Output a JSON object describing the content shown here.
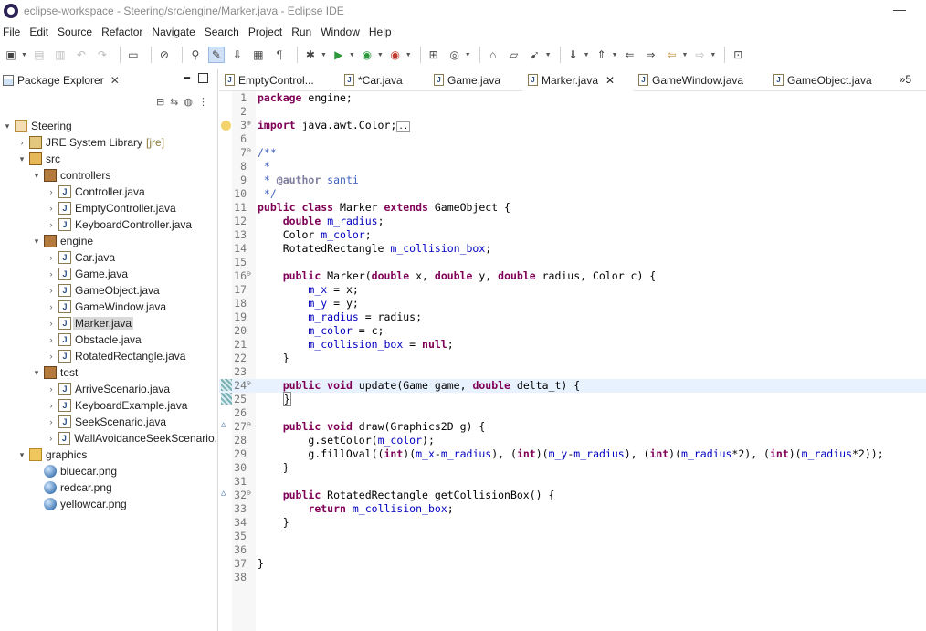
{
  "window": {
    "title": "eclipse-workspace - Steering/src/engine/Marker.java - Eclipse IDE",
    "minimize": "—"
  },
  "menu": [
    "File",
    "Edit",
    "Source",
    "Refactor",
    "Navigate",
    "Search",
    "Project",
    "Run",
    "Window",
    "Help"
  ],
  "package_explorer": {
    "title": "Package Explorer",
    "close": "✕",
    "tree": [
      {
        "depth": 0,
        "twisty": "▾",
        "icon": "project",
        "label": "Steering"
      },
      {
        "depth": 1,
        "twisty": "›",
        "icon": "lib",
        "label": "JRE System Library",
        "extra": "[jre]"
      },
      {
        "depth": 1,
        "twisty": "▾",
        "icon": "src",
        "label": "src"
      },
      {
        "depth": 2,
        "twisty": "▾",
        "icon": "pkg",
        "label": "controllers"
      },
      {
        "depth": 3,
        "twisty": "›",
        "icon": "java",
        "label": "Controller.java"
      },
      {
        "depth": 3,
        "twisty": "›",
        "icon": "java",
        "label": "EmptyController.java"
      },
      {
        "depth": 3,
        "twisty": "›",
        "icon": "java",
        "label": "KeyboardController.java"
      },
      {
        "depth": 2,
        "twisty": "▾",
        "icon": "pkg",
        "label": "engine"
      },
      {
        "depth": 3,
        "twisty": "›",
        "icon": "java",
        "label": "Car.java"
      },
      {
        "depth": 3,
        "twisty": "›",
        "icon": "java",
        "label": "Game.java"
      },
      {
        "depth": 3,
        "twisty": "›",
        "icon": "java",
        "label": "GameObject.java"
      },
      {
        "depth": 3,
        "twisty": "›",
        "icon": "java",
        "label": "GameWindow.java"
      },
      {
        "depth": 3,
        "twisty": "›",
        "icon": "java",
        "label": "Marker.java",
        "selected": true
      },
      {
        "depth": 3,
        "twisty": "›",
        "icon": "java",
        "label": "Obstacle.java"
      },
      {
        "depth": 3,
        "twisty": "›",
        "icon": "java",
        "label": "RotatedRectangle.java"
      },
      {
        "depth": 2,
        "twisty": "▾",
        "icon": "pkg",
        "label": "test"
      },
      {
        "depth": 3,
        "twisty": "›",
        "icon": "java",
        "label": "ArriveScenario.java"
      },
      {
        "depth": 3,
        "twisty": "›",
        "icon": "java",
        "label": "KeyboardExample.java"
      },
      {
        "depth": 3,
        "twisty": "›",
        "icon": "java",
        "label": "SeekScenario.java"
      },
      {
        "depth": 3,
        "twisty": "›",
        "icon": "java",
        "label": "WallAvoidanceSeekScenario."
      },
      {
        "depth": 1,
        "twisty": "▾",
        "icon": "folder",
        "label": "graphics"
      },
      {
        "depth": 2,
        "twisty": "",
        "icon": "img",
        "label": "bluecar.png"
      },
      {
        "depth": 2,
        "twisty": "",
        "icon": "img",
        "label": "redcar.png"
      },
      {
        "depth": 2,
        "twisty": "",
        "icon": "img",
        "label": "yellowcar.png"
      }
    ]
  },
  "editor_tabs": [
    {
      "label": "EmptyControl...",
      "active": false
    },
    {
      "label": "*Car.java",
      "active": false
    },
    {
      "label": "Game.java",
      "active": false
    },
    {
      "label": "Marker.java",
      "active": true,
      "close": "✕"
    },
    {
      "label": "GameWindow.java",
      "active": false
    },
    {
      "label": "GameObject.java",
      "active": false
    }
  ],
  "tabs_overflow": "»5",
  "code_lines": [
    {
      "n": "1",
      "html": "<span class='kw'>package</span> engine;"
    },
    {
      "n": "2",
      "html": ""
    },
    {
      "n": "3",
      "fold": "⊕",
      "html": "<span class='kw'>import</span> java.awt.Color;<span style='border:1px solid #999;font-size:9px;padding:0 1px'>..</span>"
    },
    {
      "n": "6",
      "html": ""
    },
    {
      "n": "7",
      "fold": "⊖",
      "html": "<span class='cmt'>/**</span>"
    },
    {
      "n": "8",
      "html": "<span class='cmt'> *</span>"
    },
    {
      "n": "9",
      "html": "<span class='cmt'> * </span><span class='tag'>@author</span><span class='cmt'> santi</span>"
    },
    {
      "n": "10",
      "html": "<span class='cmt'> */</span>"
    },
    {
      "n": "11",
      "html": "<span class='kw'>public class</span> Marker <span class='kw'>extends</span> GameObject {"
    },
    {
      "n": "12",
      "html": "    <span class='kw'>double</span> <span class='fld'>m_radius</span>;"
    },
    {
      "n": "13",
      "html": "    Color <span class='fld'>m_color</span>;"
    },
    {
      "n": "14",
      "html": "    RotatedRectangle <span class='fld'>m_collision_box</span>;"
    },
    {
      "n": "15",
      "html": ""
    },
    {
      "n": "16",
      "fold": "⊖",
      "html": "    <span class='kw'>public</span> Marker(<span class='kw'>double</span> x, <span class='kw'>double</span> y, <span class='kw'>double</span> radius, Color c) {"
    },
    {
      "n": "17",
      "html": "        <span class='fld'>m_x</span> = x;"
    },
    {
      "n": "18",
      "html": "        <span class='fld'>m_y</span> = y;"
    },
    {
      "n": "19",
      "html": "        <span class='fld'>m_radius</span> = radius;"
    },
    {
      "n": "20",
      "html": "        <span class='fld'>m_color</span> = c;"
    },
    {
      "n": "21",
      "html": "        <span class='fld'>m_collision_box</span> = <span class='kw'>null</span>;"
    },
    {
      "n": "22",
      "html": "    }"
    },
    {
      "n": "23",
      "html": ""
    },
    {
      "n": "24",
      "fold": "⊖",
      "mark": "change",
      "hl": true,
      "html": "    <span class='kw'>public void</span> update(Game game, <span class='kw'>double</span> delta_t) {"
    },
    {
      "n": "25",
      "mark": "change",
      "html": "    <span style='border:1px solid #888'>}</span>"
    },
    {
      "n": "26",
      "html": ""
    },
    {
      "n": "27",
      "fold": "⊖",
      "mark": "override",
      "html": "    <span class='kw'>public void</span> draw(Graphics2D g) {"
    },
    {
      "n": "28",
      "html": "        g.setColor(<span class='fld'>m_color</span>);"
    },
    {
      "n": "29",
      "html": "        g.fillOval((<span class='kw'>int</span>)(<span class='fld'>m_x</span>-<span class='fld'>m_radius</span>), (<span class='kw'>int</span>)(<span class='fld'>m_y</span>-<span class='fld'>m_radius</span>), (<span class='kw'>int</span>)(<span class='fld'>m_radius</span>*2), (<span class='kw'>int</span>)(<span class='fld'>m_radius</span>*2));"
    },
    {
      "n": "30",
      "html": "    }"
    },
    {
      "n": "31",
      "html": ""
    },
    {
      "n": "32",
      "fold": "⊖",
      "mark": "override",
      "html": "    <span class='kw'>public</span> RotatedRectangle getCollisionBox() {"
    },
    {
      "n": "33",
      "html": "        <span class='kw'>return</span> <span class='fld'>m_collision_box</span>;"
    },
    {
      "n": "34",
      "html": "    }"
    },
    {
      "n": "35",
      "html": ""
    },
    {
      "n": "36",
      "html": ""
    },
    {
      "n": "37",
      "html": "}"
    },
    {
      "n": "38",
      "html": ""
    }
  ]
}
